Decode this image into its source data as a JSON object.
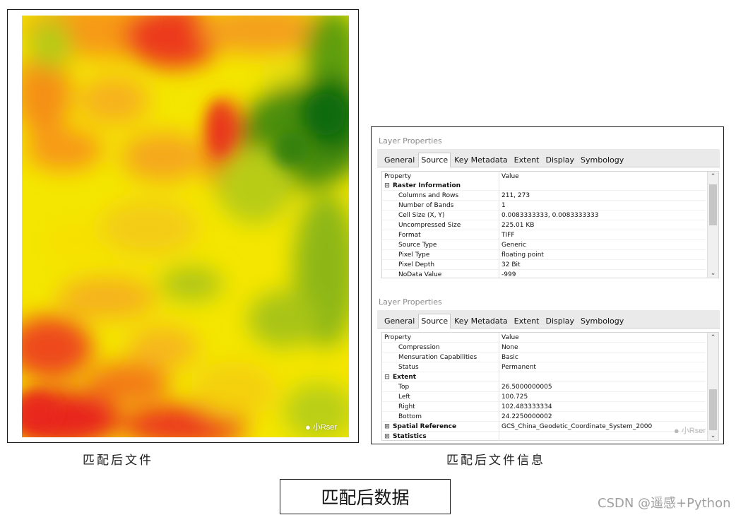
{
  "left_figure": {
    "watermark_icon": "wechat-icon",
    "watermark_text": "小Rser",
    "caption": "匹配后文件",
    "colors": {
      "red": "#e8261e",
      "orange": "#f58a18",
      "yellow": "#f4e600",
      "light_green": "#a7c814",
      "dark_green": "#0e6a08"
    }
  },
  "right_figure": {
    "caption": "匹配后文件信息",
    "watermark_text": "小Rser",
    "dialog_top": {
      "title": "Layer Properties",
      "tabs": [
        "General",
        "Source",
        "Key Metadata",
        "Extent",
        "Display",
        "Symbology"
      ],
      "active_tab": "Source",
      "header": {
        "property": "Property",
        "value": "Value"
      },
      "section": "Raster Information",
      "rows": [
        {
          "key": "Columns and Rows",
          "value": "211, 273"
        },
        {
          "key": "Number of Bands",
          "value": "1"
        },
        {
          "key": "Cell Size (X, Y)",
          "value": "0.0083333333, 0.0083333333"
        },
        {
          "key": "Uncompressed Size",
          "value": "225.01 KB"
        },
        {
          "key": "Format",
          "value": "TIFF"
        },
        {
          "key": "Source Type",
          "value": "Generic"
        },
        {
          "key": "Pixel Type",
          "value": "floating point"
        },
        {
          "key": "Pixel Depth",
          "value": "32 Bit"
        },
        {
          "key": "NoData Value",
          "value": "-999"
        }
      ]
    },
    "dialog_bottom": {
      "title": "Layer Properties",
      "tabs": [
        "General",
        "Source",
        "Key Metadata",
        "Extent",
        "Display",
        "Symbology"
      ],
      "active_tab": "Source",
      "header": {
        "property": "Property",
        "value": "Value"
      },
      "rows_before": [
        {
          "key": "Compression",
          "value": "None"
        },
        {
          "key": "Mensuration Capabilities",
          "value": "Basic"
        },
        {
          "key": "Status",
          "value": "Permanent"
        }
      ],
      "extent_section": "Extent",
      "extent_rows": [
        {
          "key": "Top",
          "value": "26.5000000005"
        },
        {
          "key": "Left",
          "value": "100.725"
        },
        {
          "key": "Right",
          "value": "102.483333334"
        },
        {
          "key": "Bottom",
          "value": "24.2250000002"
        }
      ],
      "spatial_reference": {
        "key": "Spatial Reference",
        "value": "GCS_China_Geodetic_Coordinate_System_2000"
      },
      "statistics": "Statistics"
    }
  },
  "bottom_title": "匹配后数据",
  "source_credit": "CSDN @遥感+Python"
}
